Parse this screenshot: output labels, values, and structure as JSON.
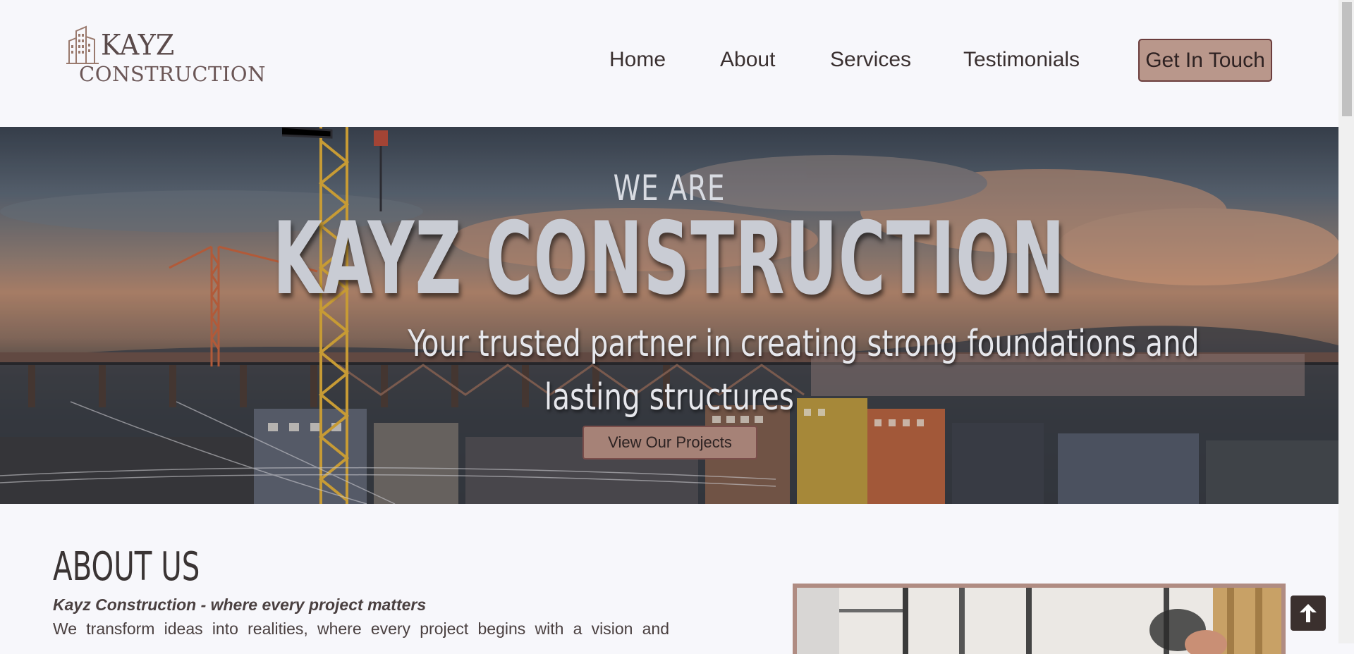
{
  "brand": {
    "line1": "KAYZ",
    "line2": "CONSTRUCTION",
    "logo_icon": "building-icon"
  },
  "nav": {
    "items": [
      {
        "label": "Home"
      },
      {
        "label": "About"
      },
      {
        "label": "Services"
      },
      {
        "label": "Testimonials"
      }
    ],
    "cta_label": "Get In Touch"
  },
  "hero": {
    "eyebrow": "WE ARE",
    "title": "KAYZ CONSTRUCTION",
    "subtitle_line1": "Your trusted partner in creating strong foundations and",
    "subtitle_line2": "lasting structures",
    "button_label": "View Our Projects"
  },
  "about": {
    "title": "ABOUT US",
    "tagline": "Kayz Construction - where every project matters",
    "body": "We transform ideas into realities, where every project begins with a vision and"
  },
  "back_to_top_icon": "arrow-up-icon",
  "colors": {
    "accent": "#b9978b",
    "accent_border": "#6b3d3d",
    "background": "#f7f7fb",
    "text": "#3a3030"
  }
}
